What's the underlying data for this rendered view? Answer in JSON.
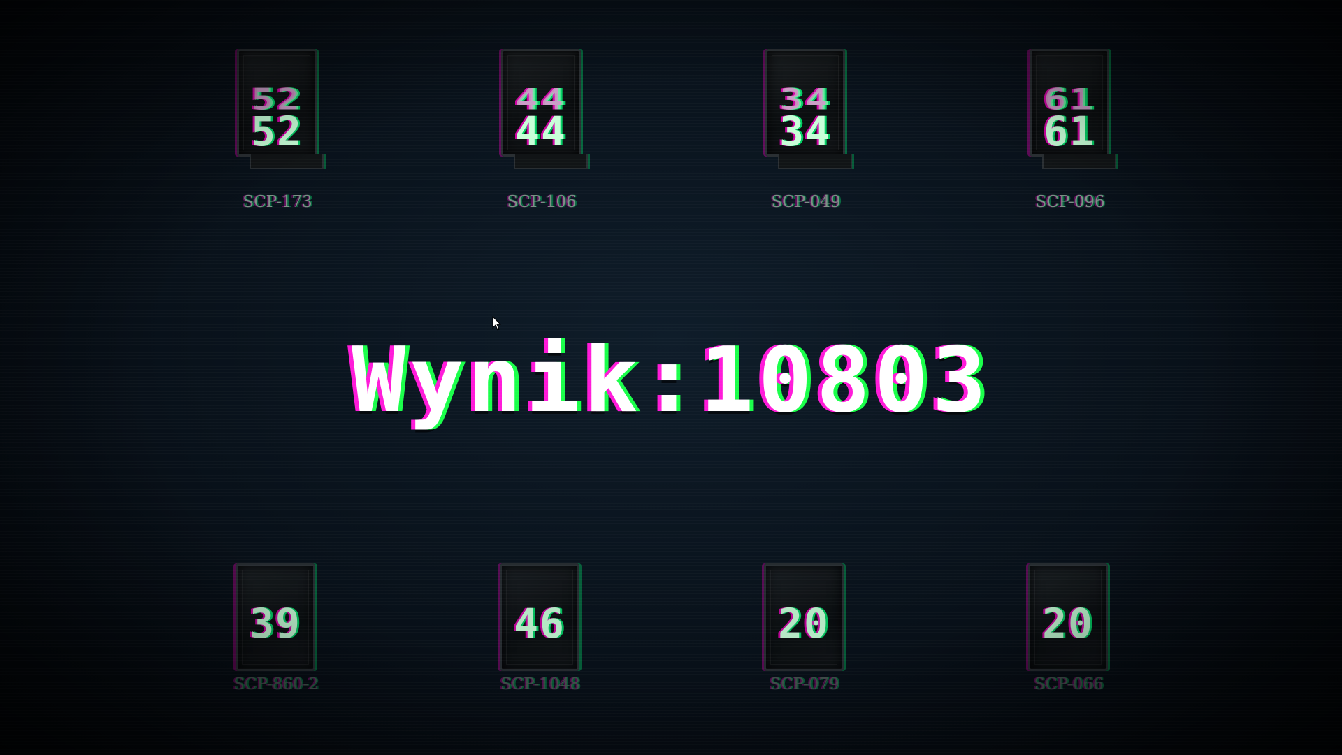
{
  "score": {
    "text": "Wynik:10803"
  },
  "cards": [
    {
      "id": "SCP-173",
      "ghost": "52",
      "number": "52"
    },
    {
      "id": "SCP-106",
      "ghost": "44",
      "number": "44"
    },
    {
      "id": "SCP-049",
      "ghost": "34",
      "number": "34"
    },
    {
      "id": "SCP-096",
      "ghost": "61",
      "number": "61"
    },
    {
      "id": "SCP-860-2",
      "number": "39"
    },
    {
      "id": "SCP-1048",
      "number": "46"
    },
    {
      "id": "SCP-079",
      "number": "20"
    },
    {
      "id": "SCP-066",
      "number": "20"
    }
  ],
  "colors": {
    "glitch_magenta": "#ff1ad9",
    "glitch_green": "#1aff4a",
    "background": "#0a141e"
  },
  "icons": {
    "cursor": "mouse-pointer-icon"
  }
}
